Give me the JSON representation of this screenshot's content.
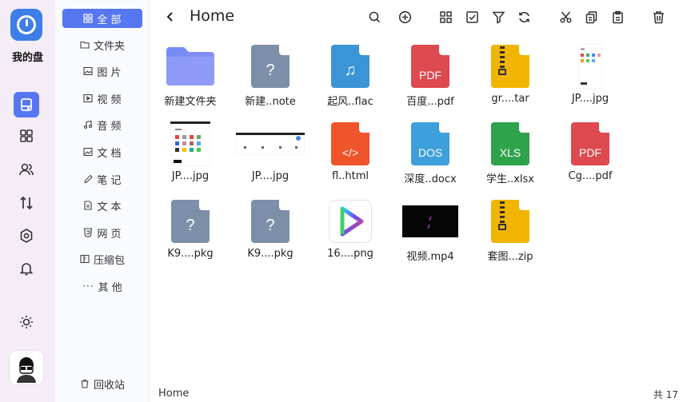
{
  "app": {
    "name": "我的盘"
  },
  "sidebar": {
    "items": [
      {
        "label": "全 部",
        "icon": "grid-icon"
      },
      {
        "label": "文件夹",
        "icon": "folder-icon"
      },
      {
        "label": "图 片",
        "icon": "image-icon"
      },
      {
        "label": "视 频",
        "icon": "video-icon"
      },
      {
        "label": "音 频",
        "icon": "music-icon"
      },
      {
        "label": "文 档",
        "icon": "document-icon"
      },
      {
        "label": "笔 记",
        "icon": "note-icon"
      },
      {
        "label": "文 本",
        "icon": "text-icon"
      },
      {
        "label": "网 页",
        "icon": "web-icon"
      },
      {
        "label": "压缩包",
        "icon": "archive-icon"
      },
      {
        "label": "其 他",
        "icon": "more-icon"
      }
    ],
    "trash": {
      "label": "回收站",
      "icon": "trash-icon"
    }
  },
  "header": {
    "title": "Home"
  },
  "files": [
    {
      "name": "新建文件夹",
      "kind": "folder",
      "color": "#7f8ef7"
    },
    {
      "name": "新建..note",
      "kind": "doc",
      "color": "#7d8fa8",
      "glyph": "?"
    },
    {
      "name": "起风..flac",
      "kind": "doc",
      "color": "#3b94d6",
      "glyph": "♫"
    },
    {
      "name": "百度...pdf",
      "kind": "doc",
      "color": "#dd4a4f",
      "glyph": "PDF"
    },
    {
      "name": "gr....tar",
      "kind": "zip",
      "color": "#f1b400"
    },
    {
      "name": "JP....jpg",
      "kind": "image-phone"
    },
    {
      "name": "JP....jpg",
      "kind": "image-phone2"
    },
    {
      "name": "JP....jpg",
      "kind": "image-wide"
    },
    {
      "name": "fl..html",
      "kind": "doc",
      "color": "#f0542b",
      "glyph": "</>"
    },
    {
      "name": "深度..docx",
      "kind": "doc",
      "color": "#3d9fdb",
      "glyph": "DOS"
    },
    {
      "name": "学生..xlsx",
      "kind": "doc",
      "color": "#2fa24c",
      "glyph": "XLS"
    },
    {
      "name": "Cg....pdf",
      "kind": "doc",
      "color": "#dd4a4f",
      "glyph": "PDF"
    },
    {
      "name": "K9....pkg",
      "kind": "doc",
      "color": "#7d8fa8",
      "glyph": "?"
    },
    {
      "name": "K9....pkg",
      "kind": "doc",
      "color": "#7d8fa8",
      "glyph": "?"
    },
    {
      "name": "16....png",
      "kind": "play-logo"
    },
    {
      "name": "视频.mp4",
      "kind": "video-thumb"
    },
    {
      "name": "套图...zip",
      "kind": "zip",
      "color": "#f1b400"
    }
  ],
  "footer": {
    "path": "Home",
    "count": "共 17"
  }
}
